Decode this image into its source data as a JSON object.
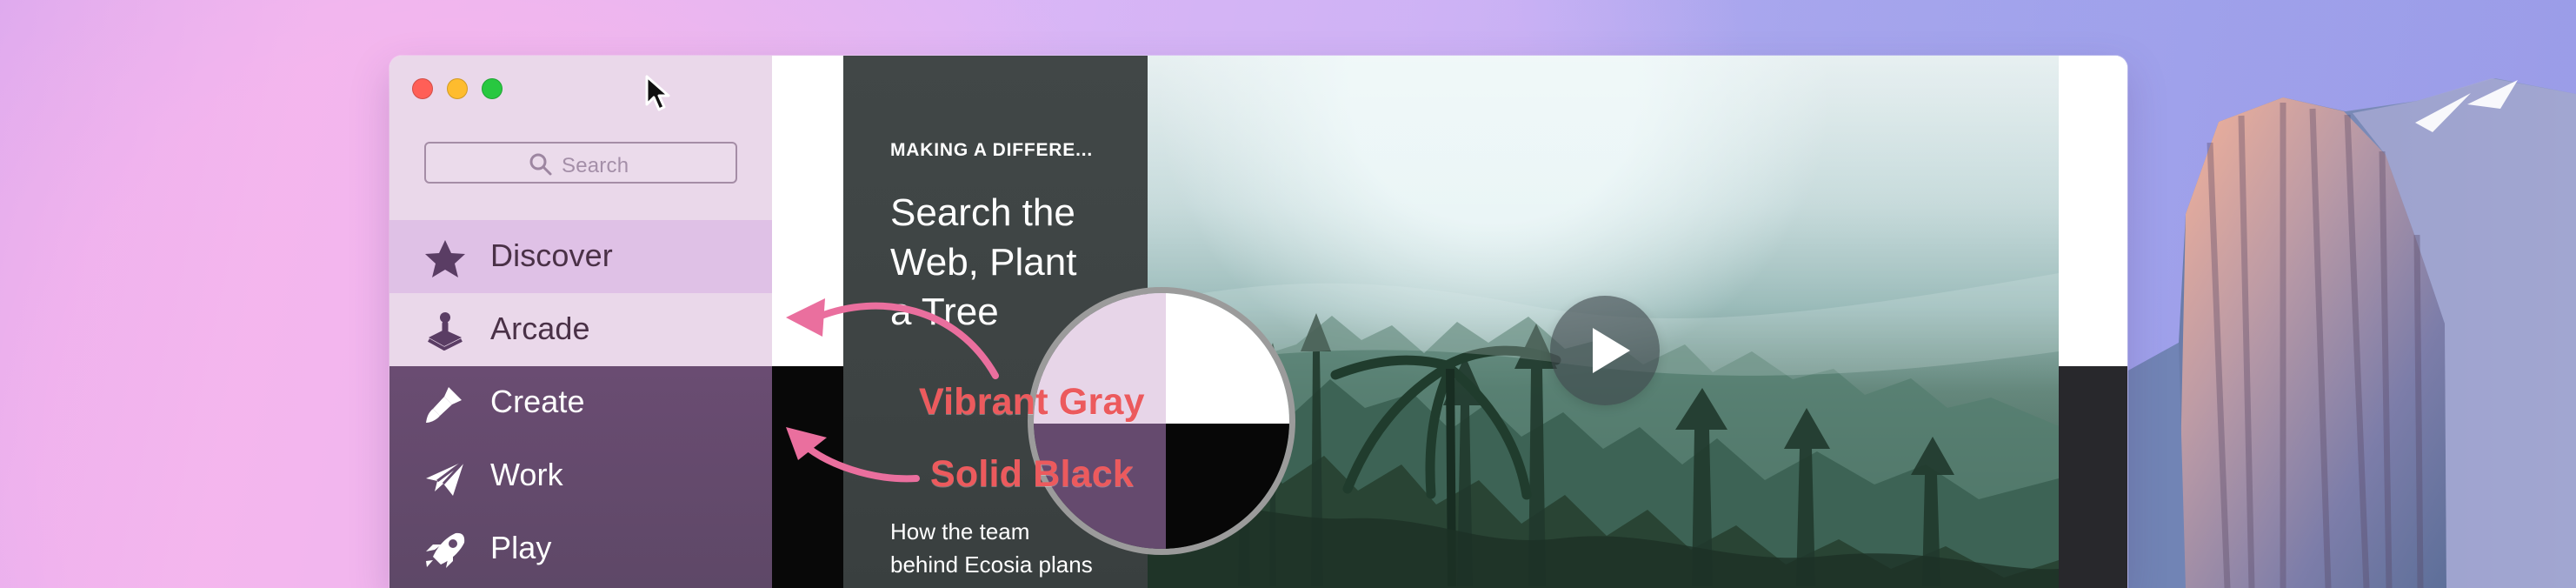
{
  "window": {
    "controls": [
      "close",
      "minimize",
      "zoom"
    ]
  },
  "search": {
    "placeholder": "Search",
    "icon": "search-icon"
  },
  "sidebar": {
    "items": [
      {
        "label": "Discover",
        "icon": "star-icon",
        "selected": true
      },
      {
        "label": "Arcade",
        "icon": "joystick-icon",
        "selected": false
      },
      {
        "label": "Create",
        "icon": "paintbrush-icon",
        "selected": false
      },
      {
        "label": "Work",
        "icon": "paper-plane-icon",
        "selected": false
      },
      {
        "label": "Play",
        "icon": "rocket-icon",
        "selected": false
      }
    ]
  },
  "featured": {
    "kicker": "MAKING A DIFFERE...",
    "title": "Search the\nWeb, Plant\na Tree",
    "description": "How the team\nbehind Ecosia plans\nto save the planet"
  },
  "annotations": {
    "vibrant_gray": "Vibrant Gray",
    "solid_black": "Solid Black"
  },
  "colors": {
    "accent": "#ec5a5d",
    "sidebar_light": "#ead8ea",
    "sidebar_dark": "#654a6e",
    "selected_row": "#dfc1e6"
  }
}
